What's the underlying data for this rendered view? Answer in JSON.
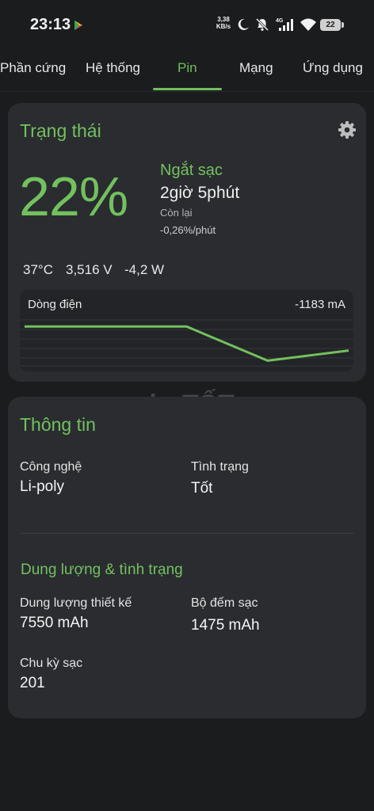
{
  "status_bar": {
    "time": "23:13",
    "net_speed_value": "3,38",
    "net_speed_unit": "KB/s",
    "network_type": "4G",
    "battery_level": "22"
  },
  "tabs": [
    {
      "label": "Phần cứng",
      "active": false
    },
    {
      "label": "Hệ thống",
      "active": false
    },
    {
      "label": "Pin",
      "active": true
    },
    {
      "label": "Mạng",
      "active": false
    },
    {
      "label": "Ứng dụng",
      "active": false
    }
  ],
  "status_card": {
    "title": "Trạng thái",
    "percent": "22%",
    "charge_state": "Ngắt sạc",
    "time_left": "2giờ 5phút",
    "time_left_label": "Còn lại",
    "rate": "-0,26%/phút",
    "temperature": "37°C",
    "voltage": "3,516 V",
    "power": "-4,2 W",
    "graph": {
      "label": "Dòng điện",
      "value": "-1183 mA",
      "series": [
        -1000,
        -1000,
        -1000,
        -1260,
        -1183
      ]
    }
  },
  "watermark": "chợTỐT",
  "info_card": {
    "title": "Thông tin",
    "technology_label": "Công nghệ",
    "technology_value": "Li-poly",
    "health_label": "Tình trạng",
    "health_value": "Tốt",
    "capacity_section_title": "Dung lượng & tình trạng",
    "design_capacity_label": "Dung lượng thiết kế",
    "design_capacity_value": "7550 mAh",
    "charge_counter_label": "Bộ đếm sạc",
    "charge_counter_value": "1475 mAh",
    "cycle_label": "Chu kỳ sạc",
    "cycle_value": "201"
  },
  "colors": {
    "accent": "#72c15e",
    "background": "#1b1c1e",
    "card": "#2a2c30"
  }
}
